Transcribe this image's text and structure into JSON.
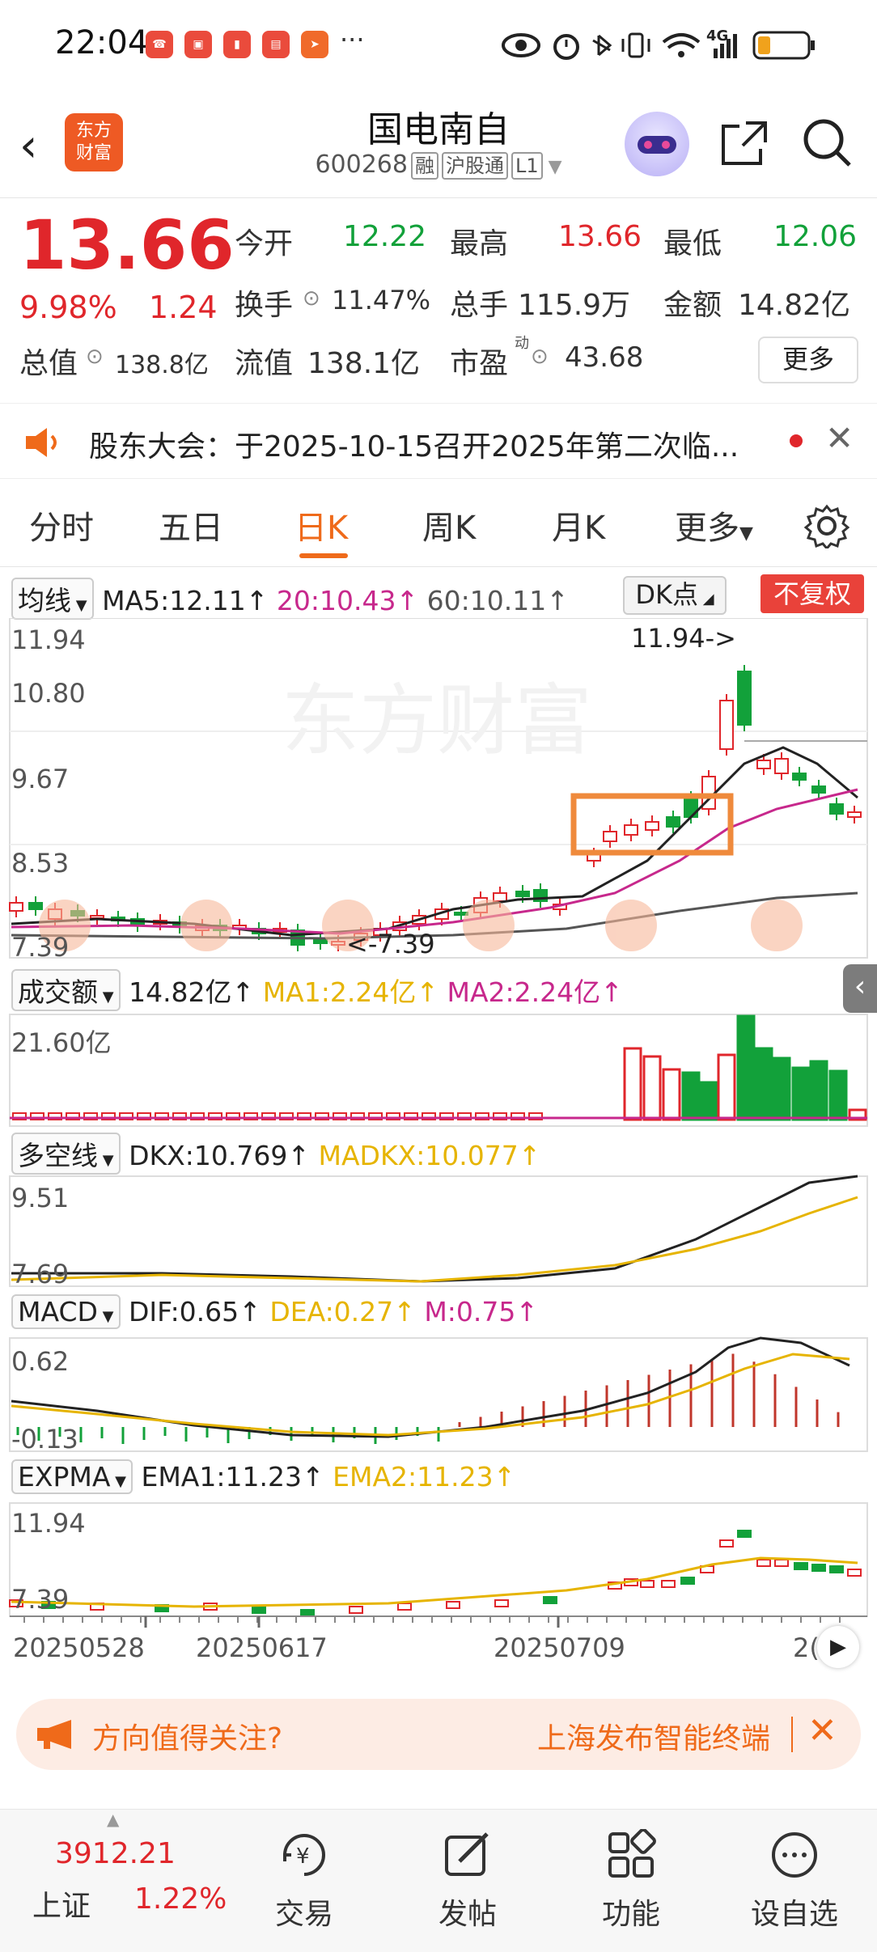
{
  "status": {
    "time": "22:04",
    "network": "4G",
    "battery_level": 0.25
  },
  "header": {
    "logo_line1": "东方",
    "logo_line2": "财富",
    "stock_name": "国电南自",
    "stock_code": "600268",
    "tags": [
      "融",
      "沪股通",
      "L1"
    ]
  },
  "quote": {
    "price": "13.66",
    "change_pct": "9.98%",
    "change": "1.24",
    "open_label": "今开",
    "open": "12.22",
    "high_label": "最高",
    "high": "13.66",
    "low_label": "最低",
    "low": "12.06",
    "turnover_label": "换手",
    "turnover": "11.47%",
    "volume_label": "总手",
    "volume": "115.9万",
    "amount_label": "金额",
    "amount": "14.82亿",
    "mktcap_label": "总值",
    "mktcap": "138.8亿",
    "float_label": "流值",
    "float": "138.1亿",
    "pe_label": "市盈",
    "pe_sup": "动",
    "pe": "43.68",
    "more_label": "更多"
  },
  "notice": {
    "text": "股东大会：于2025-10-15召开2025年第二次临..."
  },
  "tabs": [
    {
      "label": "分时"
    },
    {
      "label": "五日"
    },
    {
      "label": "日K"
    },
    {
      "label": "周K"
    },
    {
      "label": "月K"
    },
    {
      "label": "更多"
    }
  ],
  "active_tab": "日K",
  "kline": {
    "ma_dropdown": "均线",
    "ma5": "MA5:12.11↑",
    "ma20": "20:10.43↑",
    "ma60": "60:10.11↑",
    "dk_label": "DK点",
    "fq_label": "不复权",
    "y_ticks": [
      "11.94",
      "10.80",
      "9.67",
      "8.53",
      "7.39"
    ],
    "max_marker": "11.94->",
    "min_marker": "<-7.39",
    "watermark": "东方财富",
    "colors": {
      "ma5": "#222222",
      "ma20": "#c7288c",
      "ma60": "#555555",
      "up": "#e0262b",
      "down": "#12a13a",
      "highlight": "#ef8a3c"
    }
  },
  "volume": {
    "dropdown": "成交额",
    "value": "14.82亿↑",
    "ma1": "MA1:2.24亿↑",
    "ma2": "MA2:2.24亿↑",
    "y_tick": "21.60亿"
  },
  "dkx": {
    "dropdown": "多空线",
    "dkx": "DKX:10.769↑",
    "madkx": "MADKX:10.077↑",
    "y_ticks": [
      "9.51",
      "7.69"
    ]
  },
  "macd": {
    "dropdown": "MACD",
    "dif": "DIF:0.65↑",
    "dea": "DEA:0.27↑",
    "m": "M:0.75↑",
    "y_ticks": [
      "0.62",
      "-0.13"
    ]
  },
  "expma": {
    "dropdown": "EXPMA",
    "ema1": "EMA1:11.23↑",
    "ema2": "EMA2:11.23↑",
    "y_ticks": [
      "11.94",
      "7.39"
    ]
  },
  "dates": [
    "20250528",
    "20250617",
    "20250709",
    "2("
  ],
  "banner": {
    "left": "方向值得关注?",
    "right": "上海发布智能终端"
  },
  "bottom": {
    "index_value": "3912.21",
    "index_name": "上证",
    "index_pct": "1.22%",
    "items": [
      {
        "label": "交易"
      },
      {
        "label": "发帖"
      },
      {
        "label": "功能"
      },
      {
        "label": "设自选"
      }
    ]
  }
}
